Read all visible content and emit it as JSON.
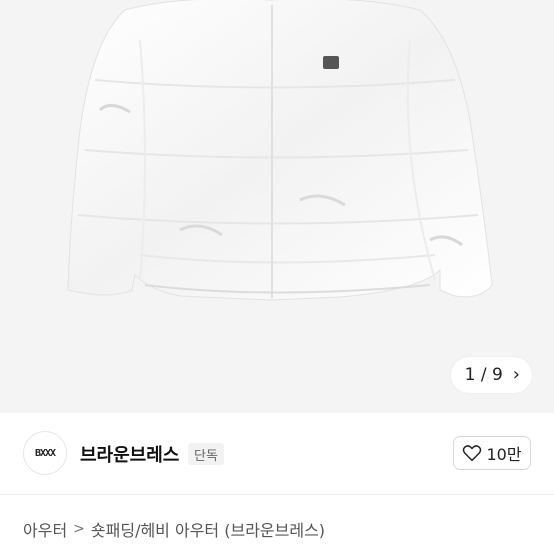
{
  "gallery": {
    "current": "1",
    "separator": "/",
    "total": "9",
    "next_icon": "chevron-right-icon"
  },
  "seller": {
    "avatar_icon": "brand-logo",
    "logo_text": "BXXX",
    "name": "브라운브레스",
    "badge": "단독"
  },
  "like": {
    "icon": "heart-outline-icon",
    "count": "10만"
  },
  "breadcrumb": {
    "category": "아우터",
    "separator": ">",
    "subcategory": "숏패딩/헤비 아우터 (브라운브레스)"
  },
  "colors": {
    "hero_bg": "#f4f4f4",
    "jacket": "#fbfbfb"
  }
}
